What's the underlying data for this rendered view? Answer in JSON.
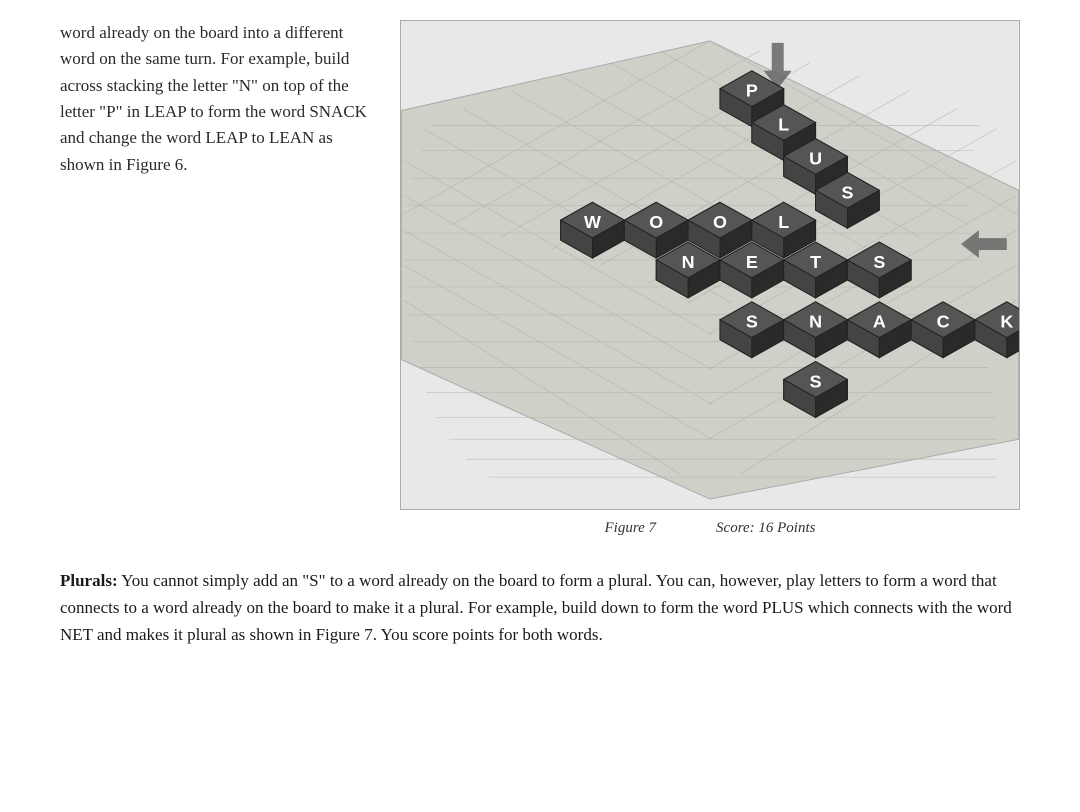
{
  "left_text": {
    "paragraph": "word already on the board into a different word on the same turn. For example, build across stacking the letter \"N\" on top of the letter \"P\" in LEAP to form the word SNACK and change the word LEAP to LEAN as shown in Figure 6."
  },
  "figure": {
    "caption_label": "Figure 7",
    "caption_score": "Score: 16 Points"
  },
  "bottom_paragraph": {
    "label": "Plurals:",
    "text": " You cannot simply add an \"S\" to a word already on the board to form a plural. You can, however, play letters to form a word that connects to a word already on the board to make it a plural. For example, build down to form the word PLUS which connects with the word NET and makes it plural as shown in Figure 7. You score points for both words."
  },
  "board": {
    "tiles": [
      {
        "letter": "P",
        "col": 5,
        "row": 1
      },
      {
        "letter": "L",
        "col": 5,
        "row": 2
      },
      {
        "letter": "U",
        "col": 5,
        "row": 3
      },
      {
        "letter": "S",
        "col": 5,
        "row": 4
      },
      {
        "letter": "W",
        "col": 1,
        "row": 5
      },
      {
        "letter": "O",
        "col": 2,
        "row": 5
      },
      {
        "letter": "O",
        "col": 3,
        "row": 5
      },
      {
        "letter": "L",
        "col": 4,
        "row": 5
      },
      {
        "letter": "N",
        "col": 3,
        "row": 6
      },
      {
        "letter": "E",
        "col": 4,
        "row": 6
      },
      {
        "letter": "T",
        "col": 5,
        "row": 6
      },
      {
        "letter": "S",
        "col": 5,
        "row": 7
      },
      {
        "letter": "N",
        "col": 4,
        "row": 7
      },
      {
        "letter": "A",
        "col": 5,
        "row": 7
      },
      {
        "letter": "C",
        "col": 6,
        "row": 7
      },
      {
        "letter": "K",
        "col": 7,
        "row": 7
      },
      {
        "letter": "S",
        "col": 4,
        "row": 8
      }
    ]
  }
}
